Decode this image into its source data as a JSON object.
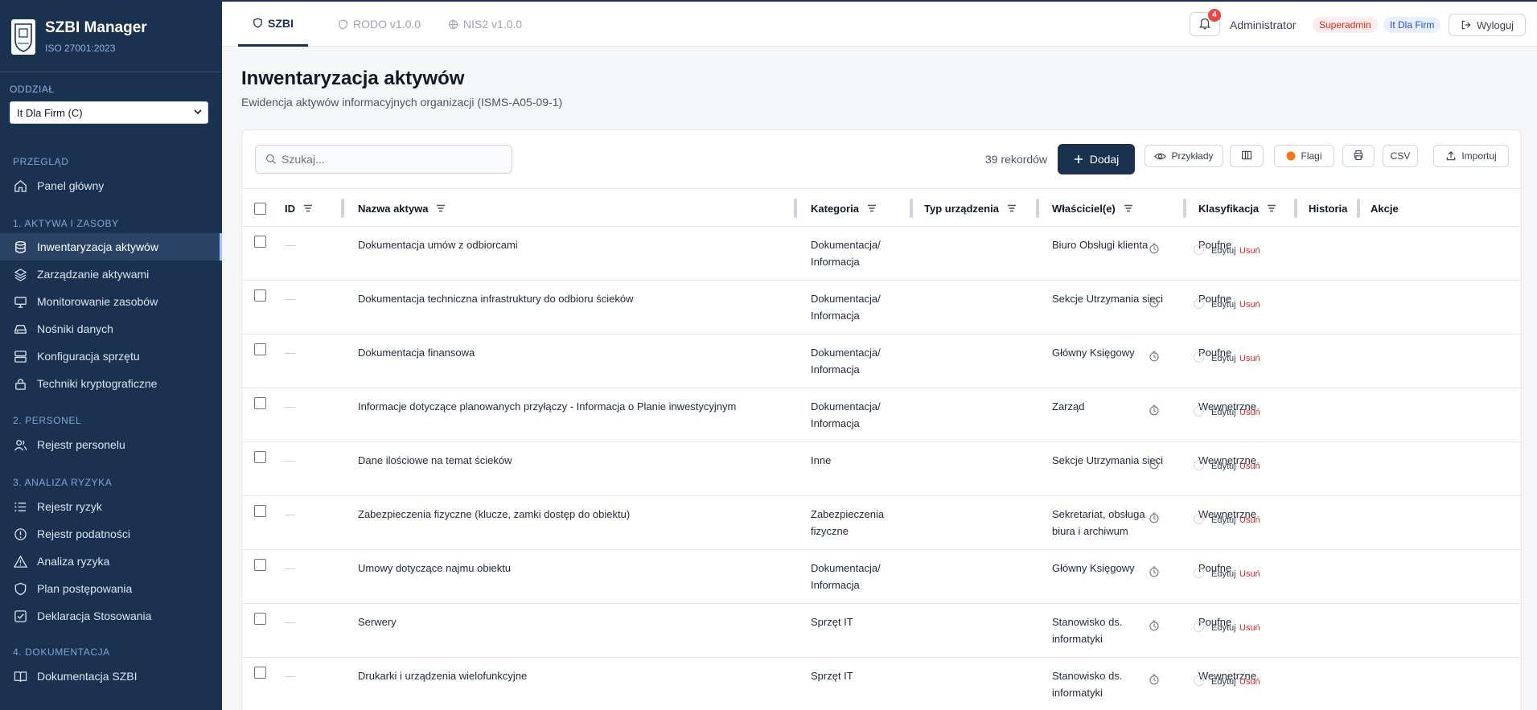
{
  "app": {
    "title": "SZBI Manager",
    "subtitle": "ISO 27001:2023"
  },
  "branch": {
    "label": "ODDZIAŁ",
    "selected": "It Dla Firm (C)"
  },
  "sidebar": {
    "sections": [
      {
        "title": "PRZEGLĄD",
        "items": [
          {
            "label": "Panel główny",
            "icon": "home-icon"
          }
        ]
      },
      {
        "title": "1. AKTYWA I ZASOBY",
        "items": [
          {
            "label": "Inwentaryzacja aktywów",
            "icon": "database-icon",
            "active": true
          },
          {
            "label": "Zarządzanie aktywami",
            "icon": "layers-icon"
          },
          {
            "label": "Monitorowanie zasobów",
            "icon": "monitor-icon"
          },
          {
            "label": "Nośniki danych",
            "icon": "hard-drive-icon"
          },
          {
            "label": "Konfiguracja sprzętu",
            "icon": "server-icon"
          },
          {
            "label": "Techniki kryptograficzne",
            "icon": "lock-icon"
          }
        ]
      },
      {
        "title": "2. PERSONEL",
        "items": [
          {
            "label": "Rejestr personelu",
            "icon": "users-icon"
          }
        ]
      },
      {
        "title": "3. ANALIZA RYZYKA",
        "items": [
          {
            "label": "Rejestr ryzyk",
            "icon": "list-icon"
          },
          {
            "label": "Rejestr podatności",
            "icon": "alert-circle-icon"
          },
          {
            "label": "Analiza ryzyka",
            "icon": "warning-triangle-icon"
          },
          {
            "label": "Plan postępowania",
            "icon": "shield-icon"
          },
          {
            "label": "Deklaracja Stosowania",
            "icon": "check-square-icon"
          }
        ]
      },
      {
        "title": "4. DOKUMENTACJA",
        "items": [
          {
            "label": "Dokumentacja SZBI",
            "icon": "book-icon"
          }
        ]
      }
    ]
  },
  "tabs": [
    {
      "label": "SZBI",
      "icon": "shield-icon",
      "active": true
    },
    {
      "label": "RODO v1.0.0",
      "icon": "shield-icon"
    },
    {
      "label": "NIS2 v1.0.0",
      "icon": "globe-icon"
    }
  ],
  "header": {
    "notifications": "4",
    "user": "Administrator",
    "role": "Superadmin",
    "org": "It Dla Firm",
    "logout": "Wyloguj"
  },
  "page": {
    "title": "Inwentaryzacja aktywów",
    "subtitle": "Ewidencja aktywów informacyjnych organizacji (ISMS-A05-09-1)"
  },
  "toolbar": {
    "search_placeholder": "Szukaj...",
    "record_count": "39 rekordów",
    "add": "Dodaj",
    "examples": "Przykłady",
    "flags": "Flagi",
    "csv": "CSV",
    "import": "Importuj"
  },
  "table": {
    "columns": [
      "ID",
      "Nazwa aktywa",
      "Kategoria",
      "Typ urządzenia",
      "Właściciel(e)",
      "Klasyfikacja",
      "Historia",
      "Akcje"
    ],
    "actions": {
      "edit": "Edytuj",
      "delete": "Usuń"
    },
    "rows": [
      {
        "id": "—",
        "name": "Dokumentacja umów z odbiorcami",
        "category": [
          "Dokumentacja/",
          "Informacja"
        ],
        "device": "",
        "owner": [
          "Biuro Obsługi klienta"
        ],
        "classification": "Poufne"
      },
      {
        "id": "—",
        "name": "Dokumentacja techniczna infrastruktury do odbioru ścieków",
        "category": [
          "Dokumentacja/",
          "Informacja"
        ],
        "device": "",
        "owner": [
          "Sekcje Utrzymania sieci"
        ],
        "classification": "Poufne"
      },
      {
        "id": "—",
        "name": "Dokumentacja finansowa",
        "category": [
          "Dokumentacja/",
          "Informacja"
        ],
        "device": "",
        "owner": [
          "Główny Księgowy"
        ],
        "classification": "Poufne"
      },
      {
        "id": "—",
        "name": "Informacje dotyczące planowanych przyłączy - Informacja o Planie inwestycyjnym",
        "category": [
          "Dokumentacja/",
          "Informacja"
        ],
        "device": "",
        "owner": [
          "Zarząd"
        ],
        "classification": "Wewnętrzne"
      },
      {
        "id": "—",
        "name": "Dane ilościowe na temat ścieków",
        "category": [
          "Inne"
        ],
        "device": "",
        "owner": [
          "Sekcje Utrzymania sieci"
        ],
        "classification": "Wewnętrzne"
      },
      {
        "id": "—",
        "name": "Zabezpieczenia fizyczne (klucze, zamki dostęp do obiektu)",
        "category": [
          "Zabezpieczenia",
          "fizyczne"
        ],
        "device": "",
        "owner": [
          "Sekretariat, obsługa",
          "biura i archiwum"
        ],
        "classification": "Wewnętrzne"
      },
      {
        "id": "—",
        "name": "Umowy dotyczące najmu obiektu",
        "category": [
          "Dokumentacja/",
          "Informacja"
        ],
        "device": "",
        "owner": [
          "Główny Księgowy"
        ],
        "classification": "Poufne"
      },
      {
        "id": "—",
        "name": "Serwery",
        "category": [
          "Sprzęt IT"
        ],
        "device": "",
        "owner": [
          "Stanowisko ds.",
          "informatyki"
        ],
        "classification": "Poufne"
      },
      {
        "id": "—",
        "name": "Drukarki i urządzenia wielofunkcyjne",
        "category": [
          "Sprzęt IT"
        ],
        "device": "",
        "owner": [
          "Stanowisko ds.",
          "informatyki"
        ],
        "classification": "Wewnętrzne"
      }
    ]
  },
  "colors": {
    "sidebar": "#1b3150",
    "accent": "#1b3150",
    "danger": "#dc2626",
    "flag": "#f97316"
  }
}
